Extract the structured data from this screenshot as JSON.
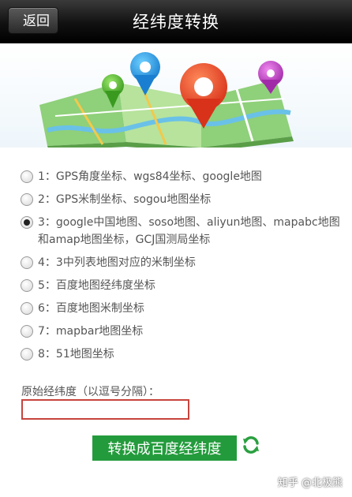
{
  "header": {
    "back_label": "返回",
    "title": "经纬度转换"
  },
  "options": [
    {
      "label": "1：GPS角度坐标、wgs84坐标、google地图",
      "checked": false
    },
    {
      "label": "2：GPS米制坐标、sogou地图坐标",
      "checked": false
    },
    {
      "label": "3：google中国地图、soso地图、aliyun地图、mapabc地图和amap地图坐标，GCJ国测局坐标",
      "checked": true
    },
    {
      "label": "4：3中列表地图对应的米制坐标",
      "checked": false
    },
    {
      "label": "5：百度地图经纬度坐标",
      "checked": false
    },
    {
      "label": "6：百度地图米制坐标",
      "checked": false
    },
    {
      "label": "7：mapbar地图坐标",
      "checked": false
    },
    {
      "label": "8：51地图坐标",
      "checked": false
    }
  ],
  "input": {
    "label": "原始经纬度（以逗号分隔）：",
    "value": "",
    "placeholder": ""
  },
  "convert_button": "转换成百度经纬度",
  "watermark": "知乎 @北极熊",
  "colors": {
    "titlebar": "#1a1a1a",
    "convert_button": "#239b3c",
    "input_border": "#c8443d"
  }
}
